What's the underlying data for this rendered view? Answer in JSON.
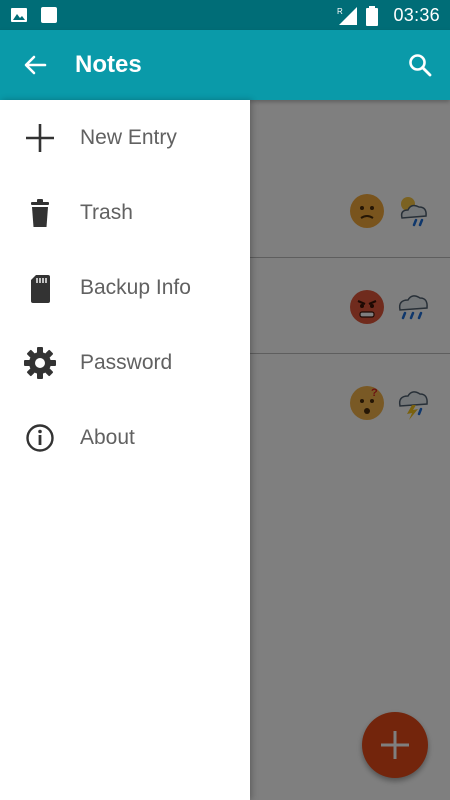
{
  "status_bar": {
    "time": "03:36",
    "left_icons": [
      "image-icon",
      "square-icon"
    ],
    "right_icons": [
      "signal-icon",
      "battery-icon"
    ]
  },
  "app_bar": {
    "title": "Notes",
    "back_icon": "arrow-left-icon",
    "search_icon": "search-icon"
  },
  "drawer": {
    "items": [
      {
        "label": "New Entry",
        "icon": "plus-icon"
      },
      {
        "label": "Trash",
        "icon": "trash-icon"
      },
      {
        "label": "Backup Info",
        "icon": "sd-card-icon"
      },
      {
        "label": "Password",
        "icon": "gear-icon"
      },
      {
        "label": "About",
        "icon": "info-icon"
      }
    ]
  },
  "entries": [
    {
      "mood": "annoyed-face",
      "weather": "partly-cloudy-rain"
    },
    {
      "mood": "angry-face",
      "weather": "rain-cloud"
    },
    {
      "mood": "confused-face",
      "weather": "thunderstorm-cloud"
    }
  ],
  "colors": {
    "status_bar": "#006d77",
    "app_bar": "#0a9aa9",
    "fab": "#e64a19",
    "drawer_text": "#616161"
  },
  "fab": {
    "icon": "plus-icon"
  }
}
